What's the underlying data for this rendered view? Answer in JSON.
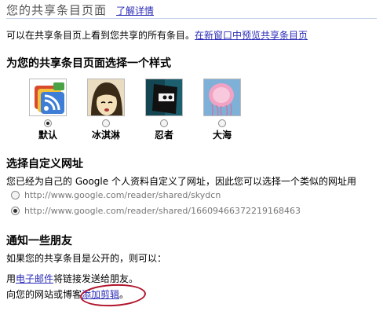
{
  "header": {
    "title": "您的共享条目页面",
    "learn_more": "了解详情"
  },
  "intro": {
    "text": "可以在共享条目页上看到您共享的所有条目。",
    "link": "在新窗口中预览共享条目页"
  },
  "style_section": {
    "heading": "为您的共享条目页面选择一个样式",
    "themes": [
      {
        "label": "默认",
        "checked": true,
        "icon": "default-theme-icon"
      },
      {
        "label": "冰淇淋",
        "checked": false,
        "icon": "ice-cream-theme-icon"
      },
      {
        "label": "忍者",
        "checked": false,
        "icon": "ninja-theme-icon"
      },
      {
        "label": "大海",
        "checked": false,
        "icon": "ocean-theme-icon"
      }
    ]
  },
  "url_section": {
    "heading": "选择自定义网址",
    "description": "您已经为自己的 Google 个人资料自定义了网址，因此您可以选择一个类似的网址用",
    "options": [
      {
        "url": "http://www.google.com/reader/shared/skydcn",
        "checked": false
      },
      {
        "url": "http://www.google.com/reader/shared/16609466372219168463",
        "checked": true
      }
    ]
  },
  "notify_section": {
    "heading": "通知一些朋友",
    "condition": "如果您的共享条目是公开的，则可以：",
    "email_prefix": "用",
    "email_link": "电子邮件",
    "email_suffix": "将链接发送给朋友。",
    "clip_prefix": "向您的网站或博客",
    "clip_link": "添加剪辑",
    "clip_suffix": "。"
  },
  "colors": {
    "link": "#2a2ab8",
    "annotation_circle": "#b0142b"
  }
}
